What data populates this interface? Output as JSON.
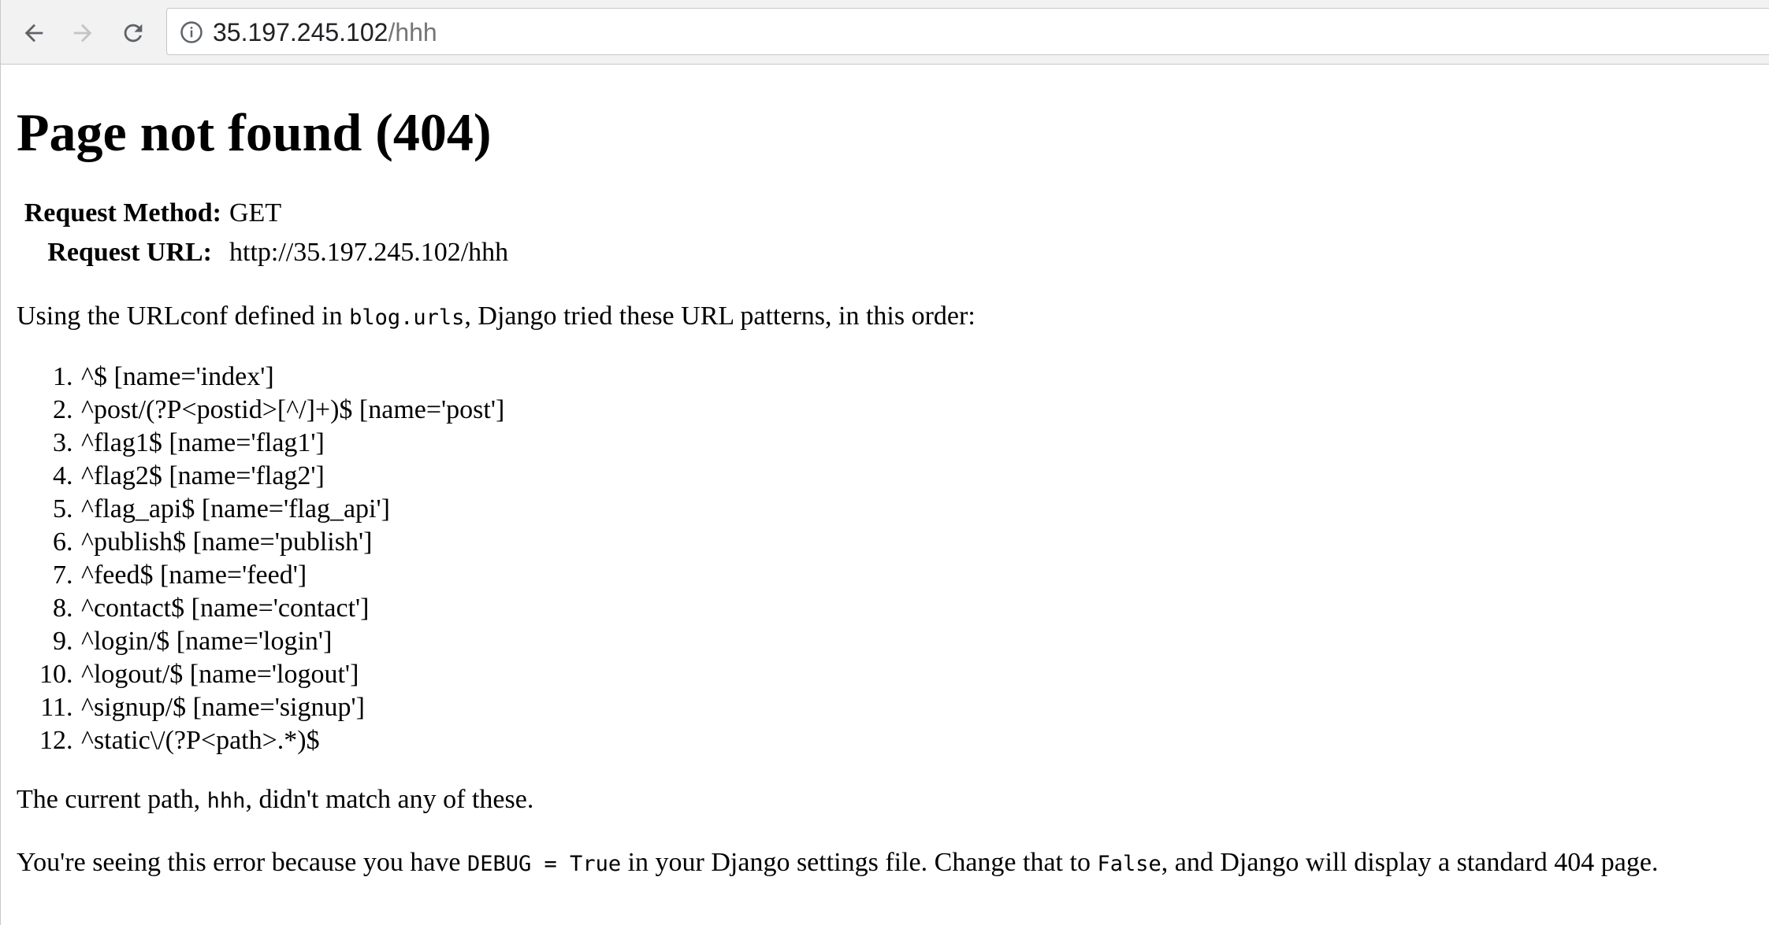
{
  "browser": {
    "url_host": "35.197.245.102",
    "url_path": "/hhh",
    "icons": {
      "back": "arrow-left-icon",
      "forward": "arrow-right-icon",
      "reload": "reload-icon",
      "site_info": "info-icon"
    }
  },
  "page": {
    "title": "Page not found (404)",
    "request": {
      "method_label": "Request Method:",
      "method_value": "GET",
      "url_label": "Request URL:",
      "url_value": "http://35.197.245.102/hhh"
    },
    "urlconf": {
      "prefix": "Using the URLconf defined in ",
      "module": "blog.urls",
      "suffix": ", Django tried these URL patterns, in this order:"
    },
    "patterns": [
      "^$ [name='index']",
      "^post/(?P<postid>[^/]+)$ [name='post']",
      "^flag1$ [name='flag1']",
      "^flag2$ [name='flag2']",
      "^flag_api$ [name='flag_api']",
      "^publish$ [name='publish']",
      "^feed$ [name='feed']",
      "^contact$ [name='contact']",
      "^login/$ [name='login']",
      "^logout/$ [name='logout']",
      "^signup/$ [name='signup']",
      "^static\\/(?P<path>.*)$"
    ],
    "current_path": {
      "prefix": "The current path, ",
      "path": "hhh",
      "suffix": ", didn't match any of these."
    },
    "debug_note": {
      "part1": "You're seeing this error because you have ",
      "code1": "DEBUG = True",
      "part2": " in your Django settings file. Change that to ",
      "code2": "False",
      "part3": ", and Django will display a standard 404 page."
    }
  }
}
